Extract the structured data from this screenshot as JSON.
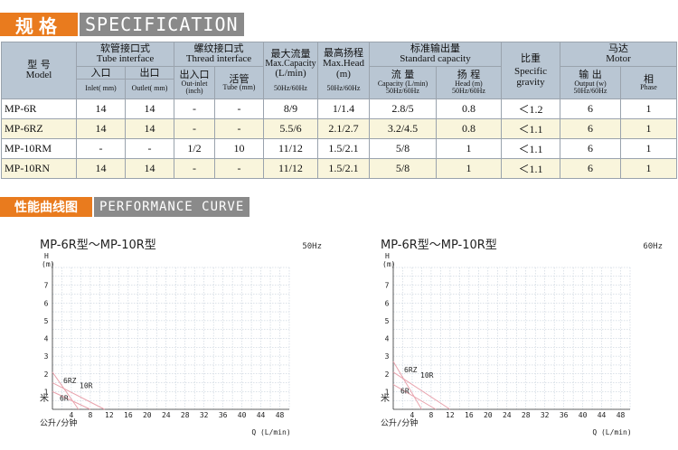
{
  "sections": {
    "spec_cn": "规格",
    "spec_en": "SPECIFICATION",
    "curve_cn": "性能曲线图",
    "curve_en": "PERFORMANCE CURVE"
  },
  "table": {
    "model_cn": "型 号",
    "model_en": "Model",
    "tube_cn": "软管接口式",
    "tube_en": "Tube interface",
    "inlet_cn": "入口",
    "inlet_en": "Inlet( mm)",
    "outlet_cn": "出口",
    "outlet_en": "Outlet( mm)",
    "thread_cn": "螺纹接口式",
    "thread_en": "Thread interface",
    "outinlet_cn": "出入口",
    "outinlet_en1": "Out-inlet",
    "outinlet_en2": "(inch)",
    "tubem_cn": "活管",
    "tubem_en": "Tube (mm)",
    "maxcap_cn": "最大流量",
    "maxcap_en": "Max.Capacity",
    "maxcap_unit": "(L/min)",
    "maxcap_freq": "50Hz/60Hz",
    "maxhead_cn": "最高扬程",
    "maxhead_en": "Max.Head",
    "maxhead_unit": "(m)",
    "maxhead_freq": "50Hz/60Hz",
    "std_cn": "标准输出量",
    "std_en": "Standard capacity",
    "flow_cn": "流 量",
    "flow_en": "Capacity (L/min)",
    "flow_freq": "50Hz/60Hz",
    "head_cn": "扬 程",
    "head_en": "Head (m)",
    "head_freq": "50Hz/60Hz",
    "sg_cn": "比重",
    "sg_en1": "Specific",
    "sg_en2": "gravity",
    "motor_cn": "马达",
    "motor_en": "Motor",
    "output_cn": "输 出",
    "output_en": "Output (w)",
    "output_freq": "50Hz/60Hz",
    "phase_cn": "相",
    "phase_en": "Phase",
    "rows": [
      {
        "model": "MP-6R",
        "inlet": "14",
        "outlet": "14",
        "outinlet": "-",
        "tube": "-",
        "maxcap": "8/9",
        "maxhead": "1/1.4",
        "flow": "2.8/5",
        "head": "0.8",
        "sg": "＜1.2",
        "output": "6",
        "phase": "1"
      },
      {
        "model": "MP-6RZ",
        "inlet": "14",
        "outlet": "14",
        "outinlet": "-",
        "tube": "-",
        "maxcap": "5.5/6",
        "maxhead": "2.1/2.7",
        "flow": "3.2/4.5",
        "head": "0.8",
        "sg": "＜1.1",
        "output": "6",
        "phase": "1"
      },
      {
        "model": "MP-10RM",
        "inlet": "-",
        "outlet": "-",
        "outinlet": "1/2",
        "tube": "10",
        "maxcap": "11/12",
        "maxhead": "1.5/2.1",
        "flow": "5/8",
        "head": "1",
        "sg": "＜1.1",
        "output": "6",
        "phase": "1"
      },
      {
        "model": "MP-10RN",
        "inlet": "14",
        "outlet": "14",
        "outinlet": "-",
        "tube": "-",
        "maxcap": "11/12",
        "maxhead": "1.5/2.1",
        "flow": "5/8",
        "head": "1",
        "sg": "＜1.1",
        "output": "6",
        "phase": "1"
      }
    ]
  },
  "chart_data": [
    {
      "type": "line",
      "title": "MP-6R型～MP-10R型",
      "frequency": "50Hz",
      "ylabel_top": "H",
      "ylabel_unit": "(m)",
      "ylabel_bottom": "米",
      "xlabel": "Q (L/min)",
      "xlabel_cn": "公升/分钟",
      "x_ticks": [
        4,
        8,
        12,
        16,
        20,
        24,
        28,
        32,
        36,
        40,
        44,
        48
      ],
      "y_ticks": [
        1,
        2,
        3,
        4,
        5,
        6,
        7
      ],
      "xlim": [
        0,
        50
      ],
      "ylim": [
        0,
        8
      ],
      "grid": true,
      "series": [
        {
          "name": "6RZ",
          "x": [
            0,
            5.5
          ],
          "y": [
            2.1,
            0
          ]
        },
        {
          "name": "10R",
          "x": [
            0,
            11
          ],
          "y": [
            1.5,
            0
          ]
        },
        {
          "name": "6R",
          "x": [
            0,
            8
          ],
          "y": [
            1.0,
            0
          ]
        }
      ]
    },
    {
      "type": "line",
      "title": "MP-6R型～MP-10R型",
      "frequency": "60Hz",
      "ylabel_top": "H",
      "ylabel_unit": "(m)",
      "ylabel_bottom": "米",
      "xlabel": "Q (L/min)",
      "xlabel_cn": "公升/分钟",
      "x_ticks": [
        4,
        8,
        12,
        16,
        20,
        24,
        28,
        32,
        36,
        40,
        44,
        48
      ],
      "y_ticks": [
        1,
        2,
        3,
        4,
        5,
        6,
        7
      ],
      "xlim": [
        0,
        50
      ],
      "ylim": [
        0,
        8
      ],
      "grid": true,
      "series": [
        {
          "name": "6RZ",
          "x": [
            0,
            6
          ],
          "y": [
            2.7,
            0
          ]
        },
        {
          "name": "10R",
          "x": [
            0,
            12
          ],
          "y": [
            2.1,
            0
          ]
        },
        {
          "name": "6R",
          "x": [
            0,
            9
          ],
          "y": [
            1.4,
            0
          ]
        }
      ]
    }
  ],
  "colors": {
    "orange": "#e97b1e",
    "gray": "#8a8a8a",
    "header": "#b9c6d3",
    "row_alt": "#f9f5dc",
    "grid": "#b9c6d3",
    "curve": "#e9a3ad"
  }
}
